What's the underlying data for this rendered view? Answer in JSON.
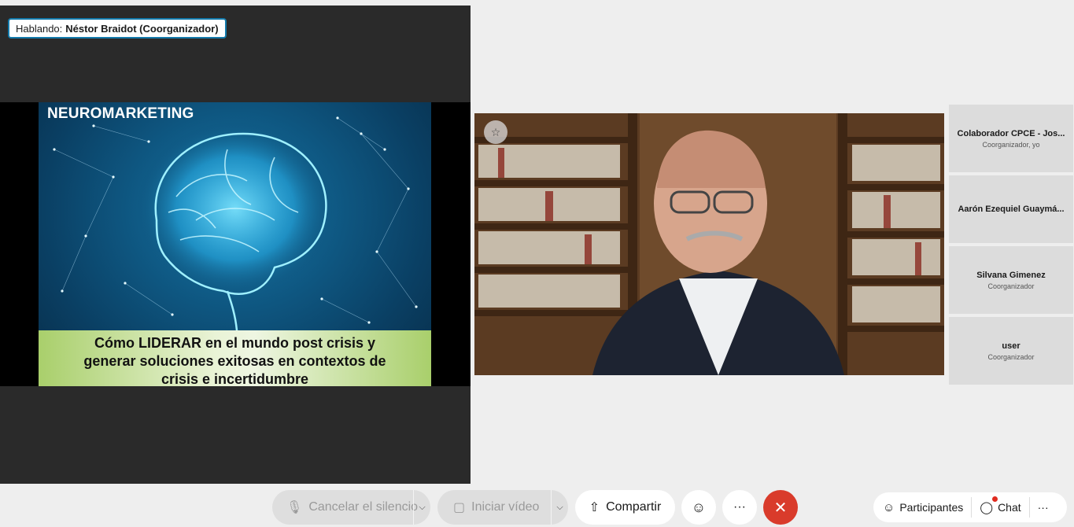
{
  "speaking": {
    "prefix": "Hablando:",
    "name": "Néstor Braidot (Coorganizador)"
  },
  "slide": {
    "title": "NEUROMARKETING",
    "caption_line1": "Cómo LIDERAR en el mundo post crisis y",
    "caption_line2": "generar soluciones exitosas en contextos de",
    "caption_line3": "crisis e incertidumbre"
  },
  "speaker_video": {
    "pin_icon": "pin-icon"
  },
  "participants": [
    {
      "name": "Colaborador CPCE - Jos...",
      "role": "Coorganizador, yo"
    },
    {
      "name": "Aarón Ezequiel Guaymá...",
      "role": ""
    },
    {
      "name": "Silvana Gimenez",
      "role": "Coorganizador"
    },
    {
      "name": "user",
      "role": "Coorganizador"
    }
  ],
  "toolbar": {
    "unmute_label": "Cancelar el silencio",
    "video_label": "Iniciar vídeo",
    "share_label": "Compartir",
    "reactions_icon": "smiley-icon",
    "more_label": "···",
    "leave_icon": "close-icon",
    "participants_label": "Participantes",
    "chat_label": "Chat",
    "overflow_label": "···"
  },
  "colors": {
    "accent_border": "#137aab",
    "leave_button": "#d93b2b",
    "chat_badge": "#e02b20"
  }
}
